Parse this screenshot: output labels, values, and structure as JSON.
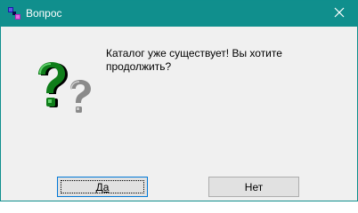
{
  "window": {
    "title": "Вопрос",
    "titlebar_color": "#108f8d",
    "app_icon": "app-window-icon",
    "close_icon": "close-icon"
  },
  "dialog": {
    "icon": "question-mark-icon",
    "message": "Каталог уже существует! Вы хотите\nпродолжить?",
    "buttons": {
      "yes_label": "Да",
      "no_label": "Нет"
    }
  },
  "colors": {
    "question_green": "#0f7d1a",
    "question_gray": "#9a9a9a",
    "focus_border": "#0078d7"
  }
}
